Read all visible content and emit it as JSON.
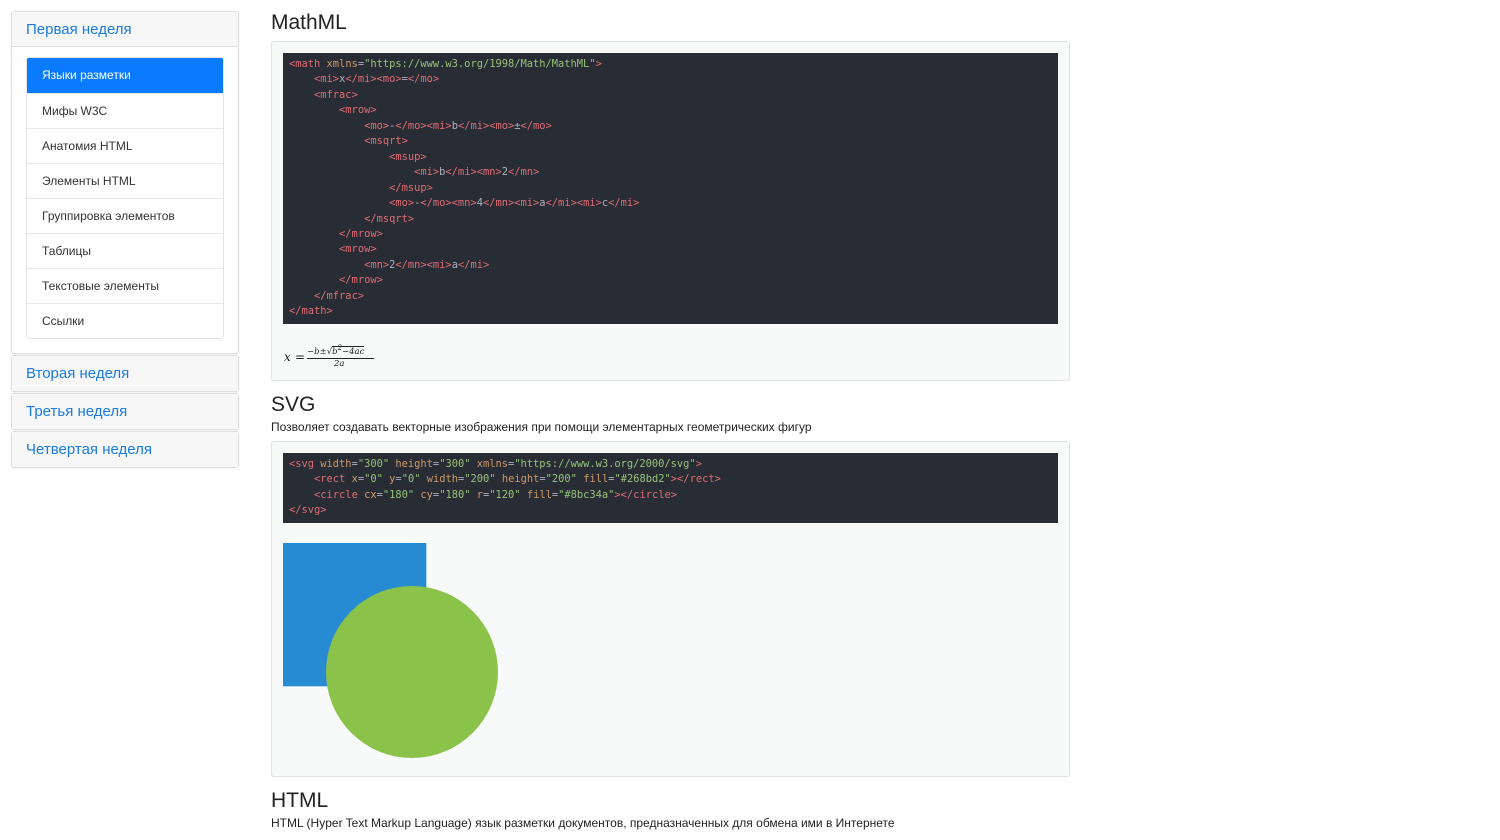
{
  "sidebar": {
    "weeks": [
      {
        "title": "Первая неделя",
        "open": true,
        "items": [
          {
            "label": "Языки разметки",
            "active": true
          },
          {
            "label": "Мифы W3C",
            "active": false
          },
          {
            "label": "Анатомия HTML",
            "active": false
          },
          {
            "label": "Элементы HTML",
            "active": false
          },
          {
            "label": "Группировка элементов",
            "active": false
          },
          {
            "label": "Таблицы",
            "active": false
          },
          {
            "label": "Текстовые элементы",
            "active": false
          },
          {
            "label": "Ссылки",
            "active": false
          }
        ]
      },
      {
        "title": "Вторая неделя",
        "open": false
      },
      {
        "title": "Третья неделя",
        "open": false
      },
      {
        "title": "Четвертая неделя",
        "open": false
      }
    ]
  },
  "mathml": {
    "title": "MathML",
    "code": [
      [
        [
          "tag",
          "<math "
        ],
        [
          "attr",
          "xmlns"
        ],
        [
          "pun",
          "="
        ],
        [
          "str",
          "\"https://www.w3.org/1998/Math/MathML\""
        ],
        [
          "tag",
          ">"
        ]
      ],
      [
        [
          "txt",
          "    "
        ],
        [
          "tag",
          "<mi>"
        ],
        [
          "txt",
          "x"
        ],
        [
          "tag",
          "</mi><mo>"
        ],
        [
          "txt",
          "="
        ],
        [
          "tag",
          "</mo>"
        ]
      ],
      [
        [
          "txt",
          "    "
        ],
        [
          "tag",
          "<mfrac>"
        ]
      ],
      [
        [
          "txt",
          "        "
        ],
        [
          "tag",
          "<mrow>"
        ]
      ],
      [
        [
          "txt",
          "            "
        ],
        [
          "tag",
          "<mo>"
        ],
        [
          "txt",
          "-"
        ],
        [
          "tag",
          "</mo><mi>"
        ],
        [
          "txt",
          "b"
        ],
        [
          "tag",
          "</mi><mo>"
        ],
        [
          "txt",
          "±"
        ],
        [
          "tag",
          "</mo>"
        ]
      ],
      [
        [
          "txt",
          "            "
        ],
        [
          "tag",
          "<msqrt>"
        ]
      ],
      [
        [
          "txt",
          "                "
        ],
        [
          "tag",
          "<msup>"
        ]
      ],
      [
        [
          "txt",
          "                    "
        ],
        [
          "tag",
          "<mi>"
        ],
        [
          "txt",
          "b"
        ],
        [
          "tag",
          "</mi><mn>"
        ],
        [
          "txt",
          "2"
        ],
        [
          "tag",
          "</mn>"
        ]
      ],
      [
        [
          "txt",
          "                "
        ],
        [
          "tag",
          "</msup>"
        ]
      ],
      [
        [
          "txt",
          "                "
        ],
        [
          "tag",
          "<mo>"
        ],
        [
          "txt",
          "-"
        ],
        [
          "tag",
          "</mo><mn>"
        ],
        [
          "txt",
          "4"
        ],
        [
          "tag",
          "</mn><mi>"
        ],
        [
          "txt",
          "a"
        ],
        [
          "tag",
          "</mi><mi>"
        ],
        [
          "txt",
          "c"
        ],
        [
          "tag",
          "</mi>"
        ]
      ],
      [
        [
          "txt",
          "            "
        ],
        [
          "tag",
          "</msqrt>"
        ]
      ],
      [
        [
          "txt",
          "        "
        ],
        [
          "tag",
          "</mrow>"
        ]
      ],
      [
        [
          "txt",
          "        "
        ],
        [
          "tag",
          "<mrow>"
        ]
      ],
      [
        [
          "txt",
          "            "
        ],
        [
          "tag",
          "<mn>"
        ],
        [
          "txt",
          "2"
        ],
        [
          "tag",
          "</mn><mi>"
        ],
        [
          "txt",
          "a"
        ],
        [
          "tag",
          "</mi>"
        ]
      ],
      [
        [
          "txt",
          "        "
        ],
        [
          "tag",
          "</mrow>"
        ]
      ],
      [
        [
          "txt",
          "    "
        ],
        [
          "tag",
          "</mfrac>"
        ]
      ],
      [
        [
          "tag",
          "</math>"
        ]
      ]
    ],
    "formula": {
      "lhs": "x",
      "eq": "=",
      "num_prefix": "−b±",
      "radicand_base": "b",
      "radicand_exp": "2",
      "radicand_rest": "−4ac",
      "denominator": "2a"
    }
  },
  "svg_section": {
    "title": "SVG",
    "description": "Позволяет создавать векторные изображения при помощи элементарных геометрических фигур",
    "code": [
      [
        [
          "tag",
          "<svg "
        ],
        [
          "attr",
          "width"
        ],
        [
          "pun",
          "="
        ],
        [
          "str",
          "\"300\""
        ],
        [
          "txt",
          " "
        ],
        [
          "attr",
          "height"
        ],
        [
          "pun",
          "="
        ],
        [
          "str",
          "\"300\""
        ],
        [
          "txt",
          " "
        ],
        [
          "attr",
          "xmlns"
        ],
        [
          "pun",
          "="
        ],
        [
          "str",
          "\"https://www.w3.org/2000/svg\""
        ],
        [
          "tag",
          ">"
        ]
      ],
      [
        [
          "txt",
          "    "
        ],
        [
          "tag",
          "<rect "
        ],
        [
          "attr",
          "x"
        ],
        [
          "pun",
          "="
        ],
        [
          "str",
          "\"0\""
        ],
        [
          "txt",
          " "
        ],
        [
          "attr",
          "y"
        ],
        [
          "pun",
          "="
        ],
        [
          "str",
          "\"0\""
        ],
        [
          "txt",
          " "
        ],
        [
          "attr",
          "width"
        ],
        [
          "pun",
          "="
        ],
        [
          "str",
          "\"200\""
        ],
        [
          "txt",
          " "
        ],
        [
          "attr",
          "height"
        ],
        [
          "pun",
          "="
        ],
        [
          "str",
          "\"200\""
        ],
        [
          "txt",
          " "
        ],
        [
          "attr",
          "fill"
        ],
        [
          "pun",
          "="
        ],
        [
          "str",
          "\"#268bd2\""
        ],
        [
          "tag",
          "></rect>"
        ]
      ],
      [
        [
          "txt",
          "    "
        ],
        [
          "tag",
          "<circle "
        ],
        [
          "attr",
          "cx"
        ],
        [
          "pun",
          "="
        ],
        [
          "str",
          "\"180\""
        ],
        [
          "txt",
          " "
        ],
        [
          "attr",
          "cy"
        ],
        [
          "pun",
          "="
        ],
        [
          "str",
          "\"180\""
        ],
        [
          "txt",
          " "
        ],
        [
          "attr",
          "r"
        ],
        [
          "pun",
          "="
        ],
        [
          "str",
          "\"120\""
        ],
        [
          "txt",
          " "
        ],
        [
          "attr",
          "fill"
        ],
        [
          "pun",
          "="
        ],
        [
          "str",
          "\"#8bc34a\""
        ],
        [
          "tag",
          "></circle>"
        ]
      ],
      [
        [
          "tag",
          "</svg>"
        ]
      ]
    ],
    "rect_color": "#268bd2",
    "circle_color": "#8bc34a"
  },
  "html_section": {
    "title": "HTML",
    "description": "HTML (Hyper Text Markup Language) язык разметки документов, предназначенных для обмена ими в Интернете"
  },
  "colors": {
    "accent": "#1a7be0",
    "active_item": "#0a7bff",
    "code_bg": "#282c34"
  }
}
